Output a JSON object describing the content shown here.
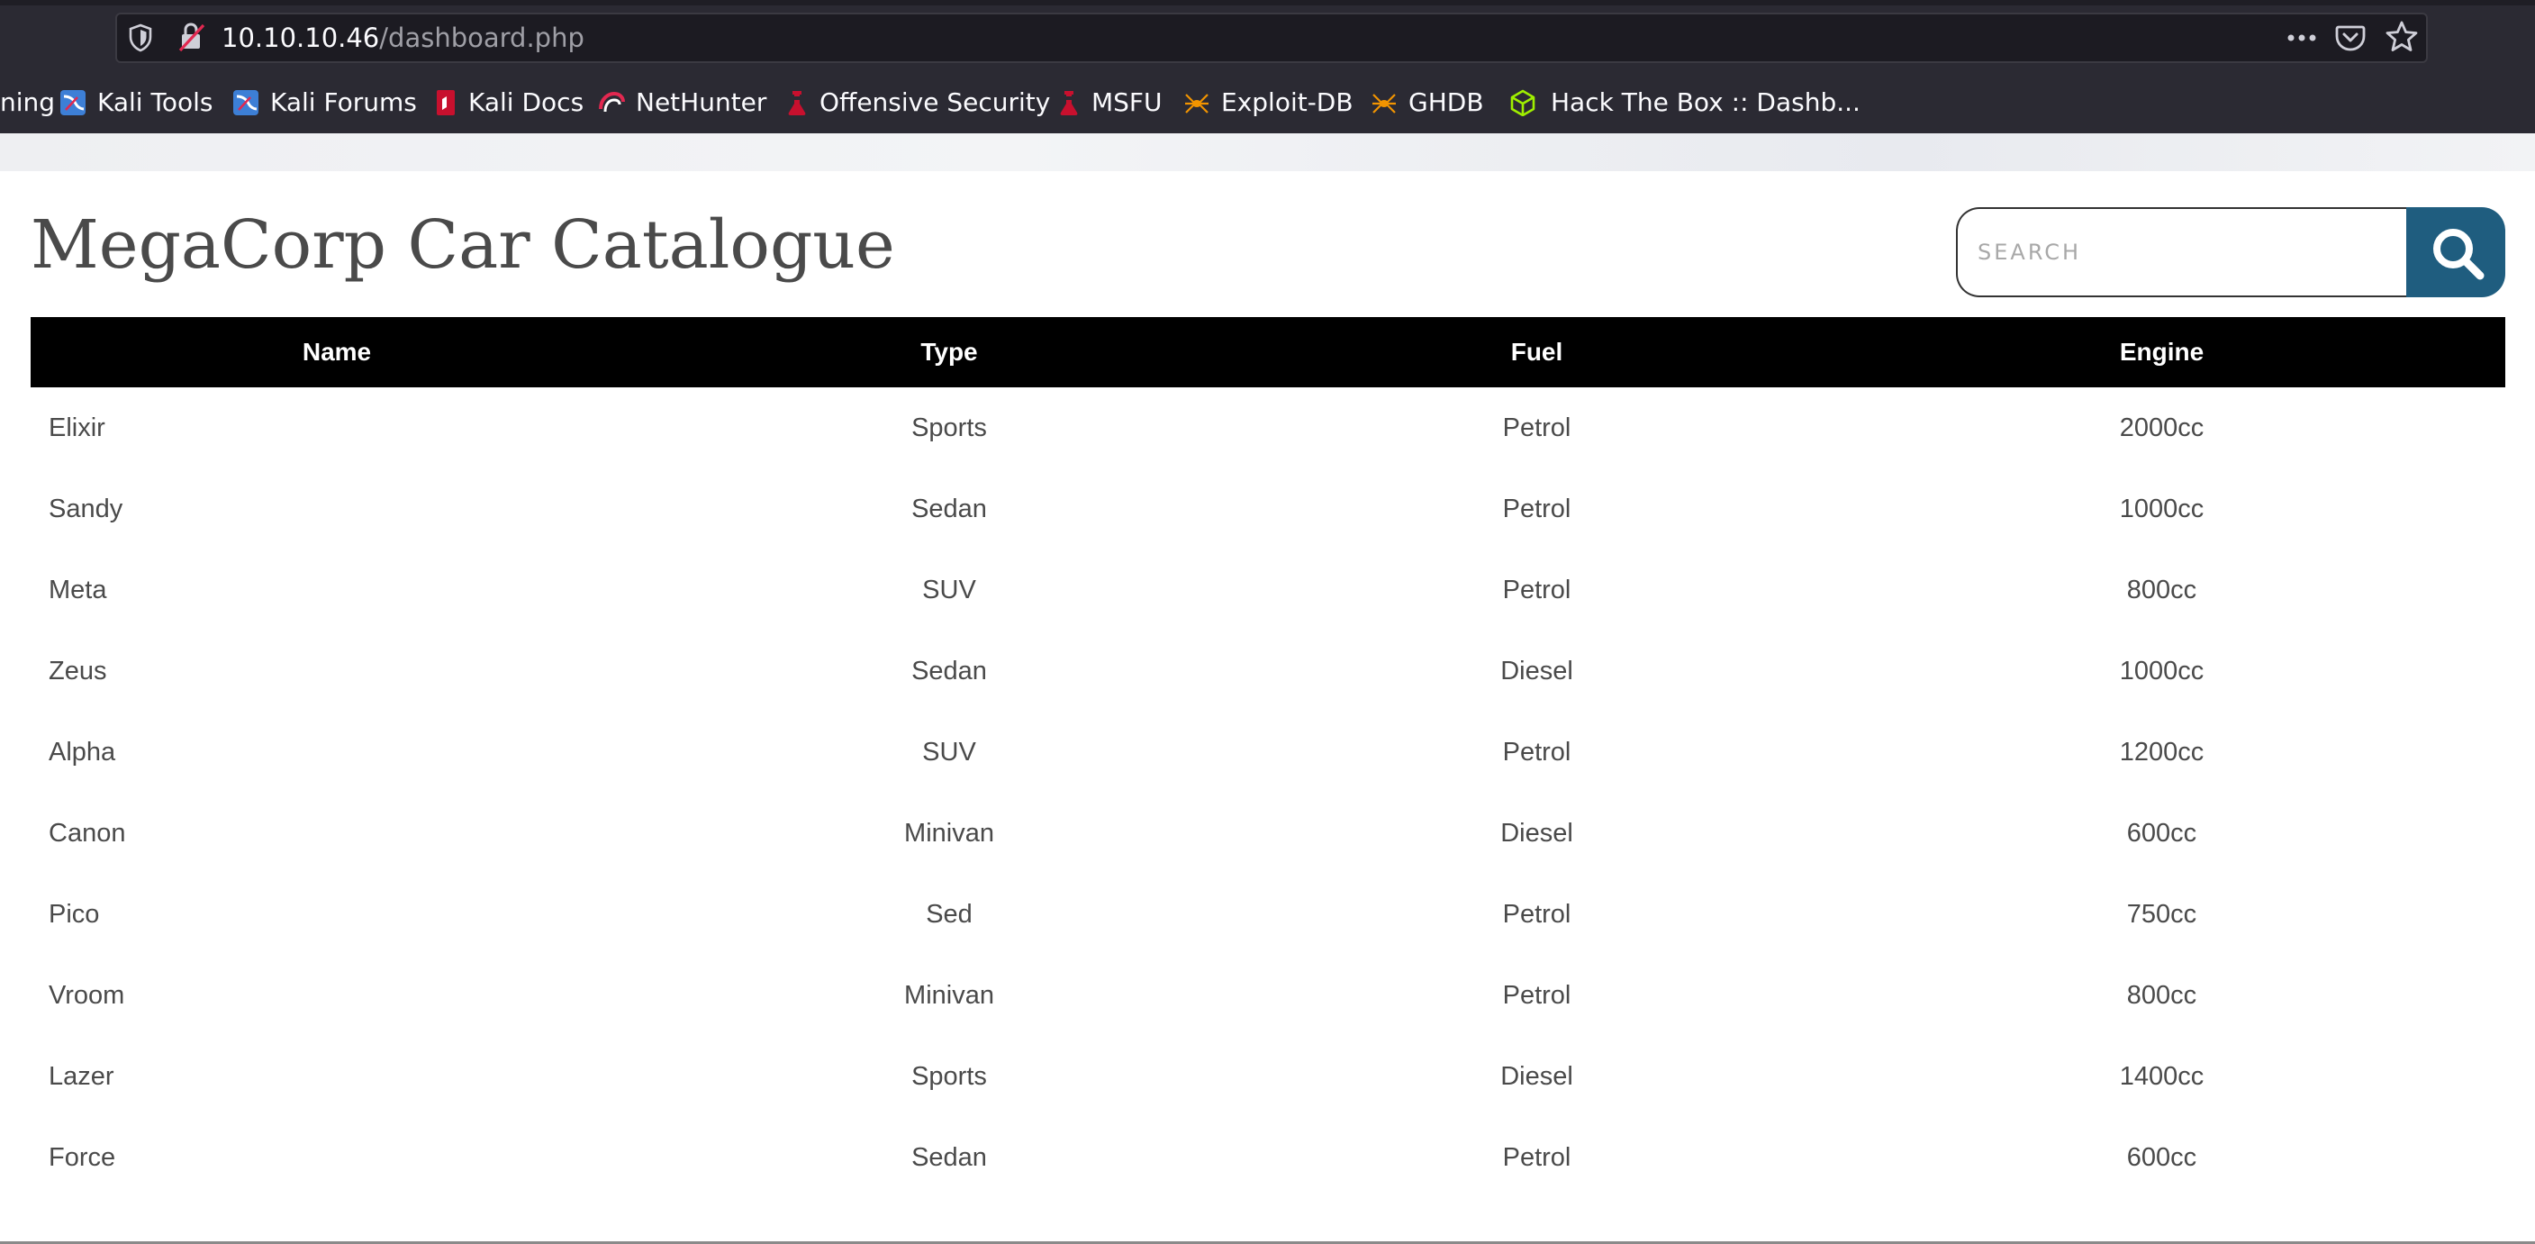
{
  "browser": {
    "url_host": "10.10.10.46",
    "url_path": "/dashboard.php",
    "bookmarks": [
      {
        "label": "ning",
        "icon": "none"
      },
      {
        "label": "Kali Tools",
        "icon": "kali-dragon-icon"
      },
      {
        "label": "Kali Forums",
        "icon": "kali-dragon-icon"
      },
      {
        "label": "Kali Docs",
        "icon": "kali-docs-icon"
      },
      {
        "label": "NetHunter",
        "icon": "nethunter-icon"
      },
      {
        "label": "Offensive Security",
        "icon": "offsec-icon"
      },
      {
        "label": "MSFU",
        "icon": "offsec-icon"
      },
      {
        "label": "Exploit-DB",
        "icon": "exploitdb-spider-icon"
      },
      {
        "label": "GHDB",
        "icon": "exploitdb-spider-icon"
      },
      {
        "label": "Hack The Box :: Dashb...",
        "icon": "htb-cube-icon"
      }
    ]
  },
  "page": {
    "title": "MegaCorp Car Catalogue",
    "search": {
      "placeholder": "SEARCH",
      "value": ""
    }
  },
  "table": {
    "headers": [
      "Name",
      "Type",
      "Fuel",
      "Engine"
    ],
    "rows": [
      [
        "Elixir",
        "Sports",
        "Petrol",
        "2000cc"
      ],
      [
        "Sandy",
        "Sedan",
        "Petrol",
        "1000cc"
      ],
      [
        "Meta",
        "SUV",
        "Petrol",
        "800cc"
      ],
      [
        "Zeus",
        "Sedan",
        "Diesel",
        "1000cc"
      ],
      [
        "Alpha",
        "SUV",
        "Petrol",
        "1200cc"
      ],
      [
        "Canon",
        "Minivan",
        "Diesel",
        "600cc"
      ],
      [
        "Pico",
        "Sed",
        "Petrol",
        "750cc"
      ],
      [
        "Vroom",
        "Minivan",
        "Petrol",
        "800cc"
      ],
      [
        "Lazer",
        "Sports",
        "Diesel",
        "1400cc"
      ],
      [
        "Force",
        "Sedan",
        "Petrol",
        "600cc"
      ]
    ]
  },
  "colors": {
    "chrome_bg": "#2b2a33",
    "urlbar_bg": "#1c1b22",
    "table_header_bg": "#000000",
    "search_button_bg": "#1f5d7f",
    "title_text": "#4a4a4a"
  }
}
